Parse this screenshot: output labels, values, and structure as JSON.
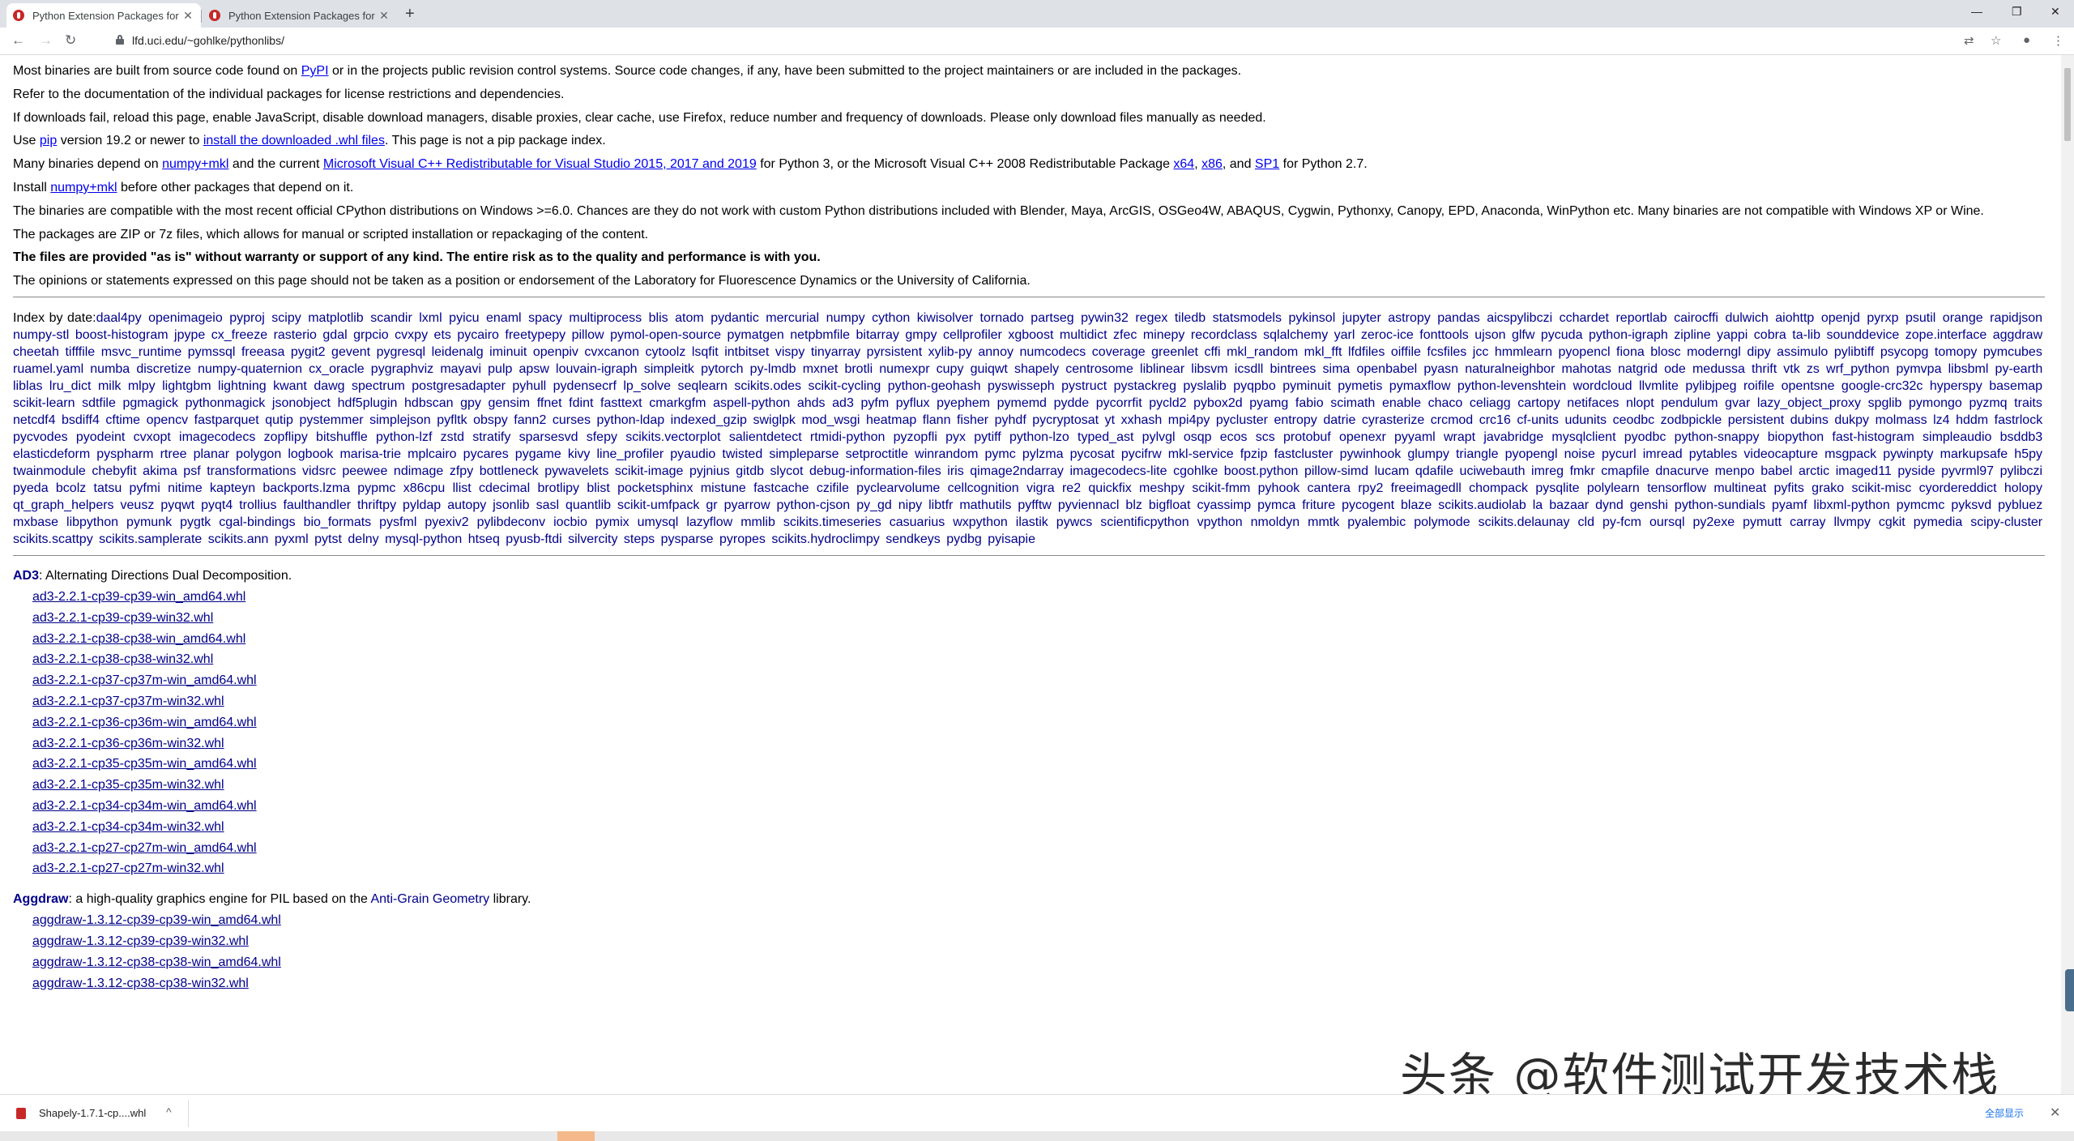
{
  "browser": {
    "tabs": [
      {
        "title": "Python Extension Packages for"
      },
      {
        "title": "Python Extension Packages for"
      }
    ],
    "url": "lfd.uci.edu/~gohlke/pythonlibs/"
  },
  "intro": [
    {
      "parts": [
        "Most binaries are built from source code found on ",
        {
          "link": "PyPI"
        },
        " or in the projects public revision control systems. Source code changes, if any, have been submitted to the project maintainers or are included in the packages."
      ]
    },
    {
      "parts": [
        "Refer to the documentation of the individual packages for license restrictions and dependencies."
      ]
    },
    {
      "parts": [
        "If downloads fail, reload this page, enable JavaScript, disable download managers, disable proxies, clear cache, use Firefox, reduce number and frequency of downloads. Please only download files manually as needed."
      ]
    },
    {
      "parts": [
        "Use ",
        {
          "link": "pip"
        },
        " version 19.2 or newer to ",
        {
          "link": "install the downloaded .whl files"
        },
        ". This page is not a pip package index."
      ]
    },
    {
      "parts": [
        "Many binaries depend on ",
        {
          "link": "numpy+mkl"
        },
        " and the current ",
        {
          "link": "Microsoft Visual C++ Redistributable for Visual Studio 2015, 2017 and 2019"
        },
        " for Python 3, or the Microsoft Visual C++ 2008 Redistributable Package ",
        {
          "link": "x64"
        },
        ", ",
        {
          "link": "x86"
        },
        ", and ",
        {
          "link": "SP1"
        },
        " for Python 2.7."
      ]
    },
    {
      "parts": [
        "Install ",
        {
          "link": "numpy+mkl"
        },
        " before other packages that depend on it."
      ]
    },
    {
      "parts": [
        "The binaries are compatible with the most recent official CPython distributions on Windows >=6.0. Chances are they do not work with custom Python distributions included with Blender, Maya, ArcGIS, OSGeo4W, ABAQUS, Cygwin, Pythonxy, Canopy, EPD, Anaconda, WinPython etc. Many binaries are not compatible with Windows XP or Wine."
      ]
    },
    {
      "parts": [
        "The packages are ZIP or 7z files, which allows for manual or scripted installation or repackaging of the content."
      ]
    },
    {
      "bold": true,
      "parts": [
        "The files are provided \"as is\" without warranty or support of any kind. The entire risk as to the quality and performance is with you."
      ]
    },
    {
      "parts": [
        "The opinions or statements expressed on this page should not be taken as a position or endorsement of the Laboratory for Fluorescence Dynamics or the University of California."
      ]
    }
  ],
  "index": {
    "label": "Index by date:",
    "items": [
      "daal4py",
      "openimageio",
      "pyproj",
      "scipy",
      "matplotlib",
      "scandir",
      "lxml",
      "pyicu",
      "enaml",
      "spacy",
      "multiprocess",
      "blis",
      "atom",
      "pydantic",
      "mercurial",
      "numpy",
      "cython",
      "kiwisolver",
      "tornado",
      "partseg",
      "pywin32",
      "regex",
      "tiledb",
      "statsmodels",
      "pykinsol",
      "jupyter",
      "astropy",
      "pandas",
      "aicspylibczi",
      "cchardet",
      "reportlab",
      "cairocffi",
      "dulwich",
      "aiohttp",
      "openjd",
      "pyrxp",
      "psutil",
      "orange",
      "rapidjson",
      "numpy-stl",
      "boost-histogram",
      "jpype",
      "cx_freeze",
      "rasterio",
      "gdal",
      "grpcio",
      "cvxpy",
      "ets",
      "pycairo",
      "freetypepy",
      "pillow",
      "pymol-open-source",
      "pymatgen",
      "netpbmfile",
      "bitarray",
      "gmpy",
      "cellprofiler",
      "xgboost",
      "multidict",
      "zfec",
      "minepy",
      "recordclass",
      "sqlalchemy",
      "yarl",
      "zeroc-ice",
      "fonttools",
      "ujson",
      "glfw",
      "pycuda",
      "python-igraph",
      "zipline",
      "yappi",
      "cobra",
      "ta-lib",
      "sounddevice",
      "zope.interface",
      "aggdraw",
      "cheetah",
      "tifffile",
      "msvc_runtime",
      "pymssql",
      "freeasa",
      "pygit2",
      "gevent",
      "pygresql",
      "leidenalg",
      "iminuit",
      "openpiv",
      "cvxcanon",
      "cytoolz",
      "lsqfit",
      "intbitset",
      "vispy",
      "tinyarray",
      "pyrsistent",
      "xylib-py",
      "annoy",
      "numcodecs",
      "coverage",
      "greenlet",
      "cffi",
      "mkl_random",
      "mkl_fft",
      "lfdfiles",
      "oiffile",
      "fcsfiles",
      "jcc",
      "hmmlearn",
      "pyopencl",
      "fiona",
      "blosc",
      "moderngl",
      "dipy",
      "assimulo",
      "pylibtiff",
      "psycopg",
      "tomopy",
      "pymcubes",
      "ruamel.yaml",
      "numba",
      "discretize",
      "numpy-quaternion",
      "cx_oracle",
      "pygraphviz",
      "mayavi",
      "pulp",
      "apsw",
      "louvain-igraph",
      "simpleitk",
      "pytorch",
      "py-lmdb",
      "mxnet",
      "brotli",
      "numexpr",
      "cupy",
      "guiqwt",
      "shapely",
      "centrosome",
      "liblinear",
      "libsvm",
      "icsdll",
      "bintrees",
      "sima",
      "openbabel",
      "pyasn",
      "naturalneighbor",
      "mahotas",
      "natgrid",
      "ode",
      "medussa",
      "thrift",
      "vtk",
      "zs",
      "wrf_python",
      "pymvpa",
      "libsbml",
      "py-earth",
      "liblas",
      "lru_dict",
      "milk",
      "mlpy",
      "lightgbm",
      "lightning",
      "kwant",
      "dawg",
      "spectrum",
      "postgresadapter",
      "pyhull",
      "pydensecrf",
      "lp_solve",
      "seqlearn",
      "scikits.odes",
      "scikit-cycling",
      "python-geohash",
      "pyswisseph",
      "pystruct",
      "pystackreg",
      "pyslalib",
      "pyqpbo",
      "pyminuit",
      "pymetis",
      "pymaxflow",
      "python-levenshtein",
      "wordcloud",
      "llvmlite",
      "pylibjpeg",
      "roifile",
      "opentsne",
      "google-crc32c",
      "hyperspy",
      "basemap",
      "scikit-learn",
      "sdtfile",
      "pgmagick",
      "pythonmagick",
      "jsonobject",
      "hdf5plugin",
      "hdbscan",
      "gpy",
      "gensim",
      "ffnet",
      "fdint",
      "fasttext",
      "cmarkgfm",
      "aspell-python",
      "ahds",
      "ad3",
      "pyfm",
      "pyflux",
      "pyephem",
      "pymemd",
      "pydde",
      "pycorrfit",
      "pycld2",
      "pybox2d",
      "pyamg",
      "fabio",
      "scimath",
      "enable",
      "chaco",
      "celiagg",
      "cartopy",
      "netifaces",
      "nlopt",
      "pendulum",
      "gvar",
      "lazy_object_proxy",
      "spglib",
      "pymongo",
      "pyzmq",
      "traits",
      "netcdf4",
      "bsdiff4",
      "cftime",
      "opencv",
      "fastparquet",
      "qutip",
      "pystemmer",
      "simplejson",
      "pyfltk",
      "obspy",
      "fann2",
      "curses",
      "python-ldap",
      "indexed_gzip",
      "swiglpk",
      "mod_wsgi",
      "heatmap",
      "flann",
      "fisher",
      "pyhdf",
      "pycryptosat",
      "yt",
      "xxhash",
      "mpi4py",
      "pycluster",
      "entropy",
      "datrie",
      "cyrasterize",
      "crcmod",
      "crc16",
      "cf-units",
      "udunits",
      "ceodbc",
      "zodbpickle",
      "persistent",
      "dubins",
      "dukpy",
      "molmass",
      "lz4",
      "hddm",
      "fastrlock",
      "pycvodes",
      "pyodeint",
      "cvxopt",
      "imagecodecs",
      "zopflipy",
      "bitshuffle",
      "python-lzf",
      "zstd",
      "stratify",
      "sparsesvd",
      "sfepy",
      "scikits.vectorplot",
      "salientdetect",
      "rtmidi-python",
      "pyzopfli",
      "pyx",
      "pytiff",
      "python-lzo",
      "typed_ast",
      "pylvgl",
      "osqp",
      "ecos",
      "scs",
      "protobuf",
      "openexr",
      "pyyaml",
      "wrapt",
      "javabridge",
      "mysqlclient",
      "pyodbc",
      "python-snappy",
      "biopython",
      "fast-histogram",
      "simpleaudio",
      "bsddb3",
      "elasticdeform",
      "pyspharm",
      "rtree",
      "planar",
      "polygon",
      "logbook",
      "marisa-trie",
      "mplcairo",
      "pycares",
      "pygame",
      "kivy",
      "line_profiler",
      "pyaudio",
      "twisted",
      "simpleparse",
      "setproctitle",
      "winrandom",
      "pymc",
      "pylzma",
      "pycosat",
      "pycifrw",
      "mkl-service",
      "fpzip",
      "fastcluster",
      "pywinhook",
      "glumpy",
      "triangle",
      "pyopengl",
      "noise",
      "pycurl",
      "imread",
      "pytables",
      "videocapture",
      "msgpack",
      "pywinpty",
      "markupsafe",
      "h5py",
      "twainmodule",
      "chebyfit",
      "akima",
      "psf",
      "transformations",
      "vidsrc",
      "peewee",
      "ndimage",
      "zfpy",
      "bottleneck",
      "pywavelets",
      "scikit-image",
      "pyjnius",
      "gitdb",
      "slycot",
      "debug-information-files",
      "iris",
      "qimage2ndarray",
      "imagecodecs-lite",
      "cgohlke",
      "boost.python",
      "pillow-simd",
      "lucam",
      "qdafile",
      "uciwebauth",
      "imreg",
      "fmkr",
      "cmapfile",
      "dnacurve",
      "menpo",
      "babel",
      "arctic",
      "imaged11",
      "pyside",
      "pyvrml97",
      "pylibczi",
      "pyeda",
      "bcolz",
      "tatsu",
      "pyfmi",
      "nitime",
      "kapteyn",
      "backports.lzma",
      "pypmc",
      "x86cpu",
      "llist",
      "cdecimal",
      "brotlipy",
      "blist",
      "pocketsphinx",
      "mistune",
      "fastcache",
      "czifile",
      "pyclearvolume",
      "cellcognition",
      "vigra",
      "re2",
      "quickfix",
      "meshpy",
      "scikit-fmm",
      "pyhook",
      "cantera",
      "rpy2",
      "freeimagedll",
      "chompack",
      "pysqlite",
      "polylearn",
      "tensorflow",
      "multineat",
      "pyfits",
      "grako",
      "scikit-misc",
      "cyordereddict",
      "holopy",
      "qt_graph_helpers",
      "veusz",
      "pyqwt",
      "pyqt4",
      "trollius",
      "faulthandler",
      "thriftpy",
      "pyldap",
      "autopy",
      "jsonlib",
      "sasl",
      "quantlib",
      "scikit-umfpack",
      "gr",
      "pyarrow",
      "python-cjson",
      "py_gd",
      "nipy",
      "libtfr",
      "mathutils",
      "pyfftw",
      "pyviennacl",
      "blz",
      "bigfloat",
      "cyassimp",
      "pymca",
      "friture",
      "pycogent",
      "blaze",
      "scikits.audiolab",
      "la",
      "bazaar",
      "dynd",
      "genshi",
      "python-sundials",
      "pyamf",
      "libxml-python",
      "pymcmc",
      "pyksvd",
      "pybluez",
      "mxbase",
      "libpython",
      "pymunk",
      "pygtk",
      "cgal-bindings",
      "bio_formats",
      "pysfml",
      "pyexiv2",
      "pylibdeconv",
      "iocbio",
      "pymix",
      "umysql",
      "lazyflow",
      "mmlib",
      "scikits.timeseries",
      "casuarius",
      "wxpython",
      "ilastik",
      "pywcs",
      "scientificpython",
      "vpython",
      "nmoldyn",
      "mmtk",
      "pyalembic",
      "polymode",
      "scikits.delaunay",
      "cld",
      "py-fcm",
      "oursql",
      "py2exe",
      "pymutt",
      "carray",
      "llvmpy",
      "cgkit",
      "pymedia",
      "scipy-cluster",
      "scikits.scattpy",
      "scikits.samplerate",
      "scikits.ann",
      "pyxml",
      "pytst",
      "delny",
      "mysql-python",
      "htseq",
      "pyusb-ftdi",
      "silvercity",
      "steps",
      "pysparse",
      "pyropes",
      "scikits.hydroclimpy",
      "sendkeys",
      "pydbg",
      "pyisapie"
    ]
  },
  "packages": [
    {
      "name": "AD3",
      "desc_parts": [
        ": Alternating Directions Dual Decomposition."
      ],
      "files": [
        "ad3-2.2.1-cp39-cp39-win_amd64.whl",
        "ad3-2.2.1-cp39-cp39-win32.whl",
        "ad3-2.2.1-cp38-cp38-win_amd64.whl",
        "ad3-2.2.1-cp38-cp38-win32.whl",
        "ad3-2.2.1-cp37-cp37m-win_amd64.whl",
        "ad3-2.2.1-cp37-cp37m-win32.whl",
        "ad3-2.2.1-cp36-cp36m-win_amd64.whl",
        "ad3-2.2.1-cp36-cp36m-win32.whl",
        "ad3-2.2.1-cp35-cp35m-win_amd64.whl",
        "ad3-2.2.1-cp35-cp35m-win32.whl",
        "ad3-2.2.1-cp34-cp34m-win_amd64.whl",
        "ad3-2.2.1-cp34-cp34m-win32.whl",
        "ad3-2.2.1-cp27-cp27m-win_amd64.whl",
        "ad3-2.2.1-cp27-cp27m-win32.whl"
      ]
    },
    {
      "name": "Aggdraw",
      "desc_parts": [
        ": a high-quality graphics engine for PIL based on the ",
        {
          "link": "Anti-Grain Geometry"
        },
        " library."
      ],
      "files": [
        "aggdraw-1.3.12-cp39-cp39-win_amd64.whl",
        "aggdraw-1.3.12-cp39-cp39-win32.whl",
        "aggdraw-1.3.12-cp38-cp38-win_amd64.whl",
        "aggdraw-1.3.12-cp38-cp38-win32.whl"
      ]
    }
  ],
  "download_bar": {
    "file": "Shapely-1.7.1-cp....whl",
    "show_all": "全部显示"
  },
  "watermark": "头条 @软件测试开发技术栈"
}
